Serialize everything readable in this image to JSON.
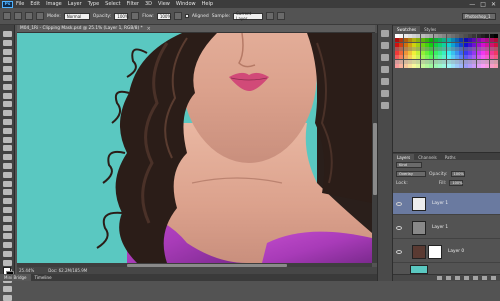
{
  "app": {
    "logo": "Ps"
  },
  "menubar": {
    "items": [
      "File",
      "Edit",
      "Image",
      "Layer",
      "Type",
      "Select",
      "Filter",
      "3D",
      "View",
      "Window",
      "Help"
    ],
    "window_buttons": [
      "—",
      "□",
      "✕"
    ]
  },
  "options": {
    "mode_label": "Mode:",
    "mode_value": "Normal",
    "opacity_label": "Opacity:",
    "opacity_value": "100%",
    "flow_label": "Flow:",
    "flow_value": "100%",
    "aligned_label": "Aligned",
    "sample_label": "Sample:",
    "sample_value": "Current Layer",
    "workspace": "Photoshop_1"
  },
  "document": {
    "tab_title": "M04_1Ri - Clipping Mask.psd @ 25.1% (Layer 1, RGB/8) *",
    "zoom": "25.44%",
    "doc_size": "Doc: 62.2M/185.9M"
  },
  "bottom_tabs": [
    "Mini Bridge",
    "Timeline"
  ],
  "swatches_panel": {
    "tabs": [
      "Swatches",
      "Styles"
    ]
  },
  "layers_panel": {
    "tabs": [
      "Layers",
      "Channels",
      "Paths"
    ],
    "kind_label": "Kind",
    "blend_mode": "Overlay",
    "opacity_label": "Opacity:",
    "opacity_value": "100%",
    "lock_label": "Lock:",
    "fill_label": "Fill:",
    "fill_value": "100%",
    "layers": [
      {
        "name": "Layer 1",
        "selected": true
      },
      {
        "name": "Layer 1"
      },
      {
        "name": "Layer 0"
      }
    ]
  },
  "colors": {
    "canvas_background": "#5ac8c1",
    "selected_layer": "#6a7aa0"
  }
}
